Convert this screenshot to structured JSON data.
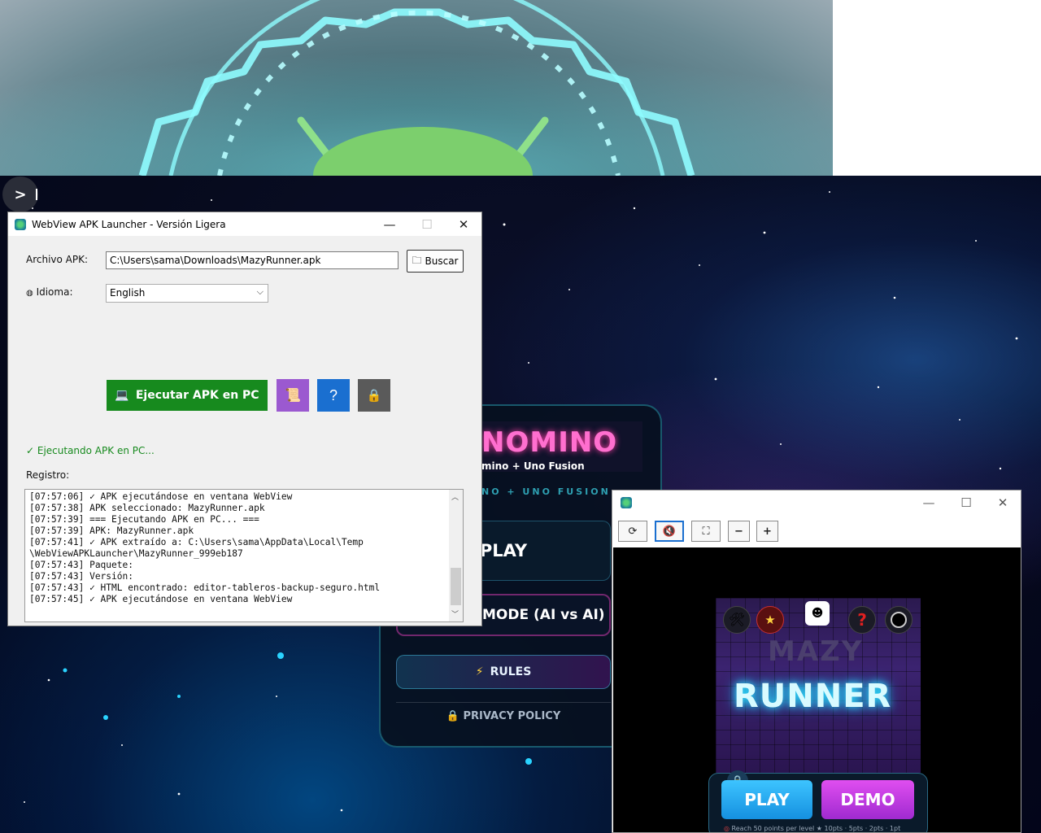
{
  "prompt": {
    "symbol": ">"
  },
  "menu": {
    "logo": "NOMINO",
    "logo_sub": "mino + Uno Fusion",
    "tagline": "NO + UNO FUSION",
    "play": "PLAY",
    "demo": "MODE (AI vs AI)",
    "rules": "RULES",
    "privacy": "PRIVACY POLICY"
  },
  "launcher": {
    "title": "WebView APK Launcher - Versión Ligera",
    "apk_label": "Archivo APK:",
    "apk_path": "C:\\Users\\sama\\Downloads\\MazyRunner.apk",
    "browse_button": "Buscar",
    "lang_label": "Idioma:",
    "lang_value": "English",
    "run_button": "Ejecutar APK en PC",
    "status": "✓ Ejecutando APK en PC...",
    "log_label": "Registro:",
    "log": [
      "[07:57:06] ✓ APK ejecutándose en ventana WebView",
      "[07:57:38] APK seleccionado: MazyRunner.apk",
      "[07:57:39] === Ejecutando APK en PC... ===",
      "[07:57:39] APK: MazyRunner.apk",
      "[07:57:41] ✓ APK extraído a: C:\\Users\\sama\\AppData\\Local\\Temp",
      "\\WebViewAPKLauncher\\MazyRunner_999eb187",
      "[07:57:43] Paquete:",
      "[07:57:43] Versión:",
      "[07:57:43] ✓ HTML encontrado: editor-tableros-backup-seguro.html",
      "[07:57:45] ✓ APK ejecutándose en ventana WebView"
    ]
  },
  "game": {
    "toolbar": {
      "reload": "⟳",
      "zoom_out": "−",
      "zoom_in": "+"
    },
    "title_top": "MAZY",
    "title_main": "RUNNER",
    "play": "PLAY",
    "demo": "DEMO",
    "footer": "Reach 50 points per level   ★ 10pts · 5pts · 2pts · 1pt"
  },
  "colors": {
    "run_button": "#178a1e",
    "notes_button": "#9b59d0",
    "help_button": "#1a6fd0",
    "lock_button": "#5a5a5a",
    "status_text": "#178a1e"
  }
}
